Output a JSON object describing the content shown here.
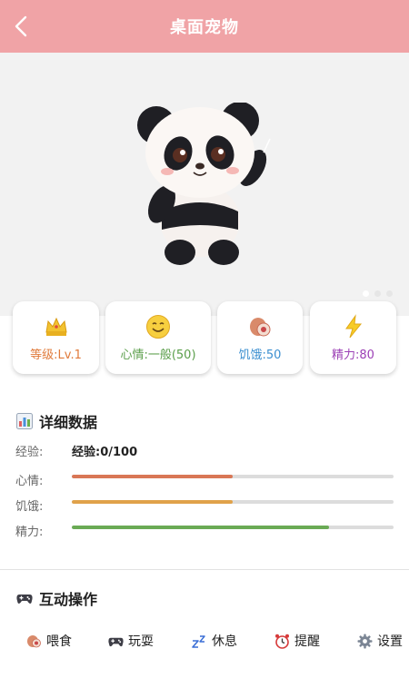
{
  "header": {
    "title": "桌面宠物"
  },
  "pet": {
    "image_name": "panda-pet",
    "carousel_pages": 3,
    "carousel_active": 0
  },
  "stats": [
    {
      "icon": "crown-icon",
      "label": "等级:Lv.1",
      "color": "#e07a3a"
    },
    {
      "icon": "smile-icon",
      "label": "心情:一般(50)",
      "color": "#5a9e4a"
    },
    {
      "icon": "meat-icon",
      "label": "饥饿:50",
      "color": "#3b8fd0"
    },
    {
      "icon": "lightning-icon",
      "label": "精力:80",
      "color": "#9b3fb5"
    }
  ],
  "details": {
    "title": "详细数据",
    "exp_label": "经验:",
    "exp_value": "经验:0/100",
    "bars": [
      {
        "label": "心情:",
        "value": 50,
        "max": 100,
        "color": "#d97756"
      },
      {
        "label": "饥饿:",
        "value": 50,
        "max": 100,
        "color": "#e0a24a"
      },
      {
        "label": "精力:",
        "value": 80,
        "max": 100,
        "color": "#6aaa55"
      }
    ]
  },
  "actions_section": {
    "title": "互动操作",
    "items": [
      {
        "icon": "meat-icon",
        "label": "喂食"
      },
      {
        "icon": "gamepad-icon",
        "label": "玩耍"
      },
      {
        "icon": "sleep-icon",
        "label": "休息"
      },
      {
        "icon": "alarm-clock-icon",
        "label": "提醒"
      },
      {
        "icon": "gear-icon",
        "label": "设置"
      }
    ]
  }
}
